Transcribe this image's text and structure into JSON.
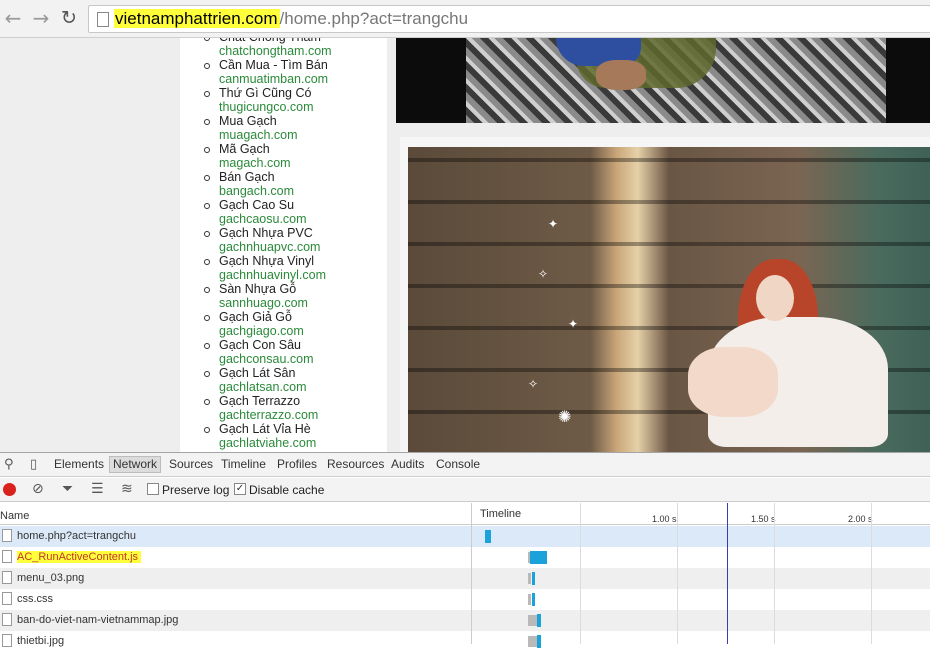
{
  "browser": {
    "url_host": "vietnamphattrien.com",
    "url_path": "/home.php?act=trangchu"
  },
  "link_list": [
    {
      "title": "Chất Chống Thấm",
      "domain": "chatchongtham.com"
    },
    {
      "title": "Cần Mua - Tìm Bán",
      "domain": "canmuatimban.com"
    },
    {
      "title": "Thứ Gì Cũng Có",
      "domain": "thugicungco.com"
    },
    {
      "title": "Mua Gạch",
      "domain": "muagach.com"
    },
    {
      "title": "Mã Gạch",
      "domain": "magach.com"
    },
    {
      "title": "Bán Gạch",
      "domain": "bangach.com"
    },
    {
      "title": "Gạch Cao Su",
      "domain": "gachcaosu.com"
    },
    {
      "title": "Gạch Nhựa PVC",
      "domain": "gachnhuapvc.com"
    },
    {
      "title": "Gạch Nhựa Vinyl",
      "domain": "gachnhuavinyl.com"
    },
    {
      "title": "Sàn Nhựa Gỗ",
      "domain": "sannhuago.com"
    },
    {
      "title": "Gạch Giả Gỗ",
      "domain": "gachgiago.com"
    },
    {
      "title": "Gạch Con Sâu",
      "domain": "gachconsau.com"
    },
    {
      "title": "Gạch Lát Sân",
      "domain": "gachlatsan.com"
    },
    {
      "title": "Gạch Terrazzo",
      "domain": "gachterrazzo.com"
    },
    {
      "title": "Gạch Lát Vỉa Hè",
      "domain": "gachlatviahe.com"
    }
  ],
  "devtools": {
    "tabs": [
      "Elements",
      "Network",
      "Sources",
      "Timeline",
      "Profiles",
      "Resources",
      "Audits",
      "Console"
    ],
    "active_tab": "Network",
    "toolbar": {
      "preserve_log_label": "Preserve log",
      "preserve_log_checked": false,
      "disable_cache_label": "Disable cache",
      "disable_cache_checked": true
    },
    "columns": {
      "name": "Name",
      "timeline": "Timeline"
    },
    "ticks": [
      "1.00 s",
      "1.50 s",
      "2.00 s"
    ],
    "requests": [
      {
        "name": "home.php?act=trangchu",
        "wait": [
          0.01,
          0.0
        ],
        "recv": [
          0.01,
          0.03
        ]
      },
      {
        "name": "AC_RunActiveContent.js",
        "highlighted": true,
        "wait": [
          0.23,
          0.01
        ],
        "recv": [
          0.24,
          0.09
        ]
      },
      {
        "name": "menu_03.png",
        "wait": [
          0.23,
          0.02
        ],
        "recv": [
          0.25,
          0.02
        ]
      },
      {
        "name": "css.css",
        "wait": [
          0.23,
          0.02
        ],
        "recv": [
          0.25,
          0.01
        ]
      },
      {
        "name": "ban-do-viet-nam-vietnammap.jpg",
        "wait": [
          0.23,
          0.05
        ],
        "recv": [
          0.28,
          0.02
        ]
      },
      {
        "name": "thietbi.jpg",
        "wait": [
          0.23,
          0.05
        ],
        "recv": [
          0.28,
          0.02
        ]
      }
    ],
    "colors": {
      "waiting": "#b9b9b9",
      "receiving": "#1ba2da",
      "highlight": "#ffff3c"
    }
  }
}
